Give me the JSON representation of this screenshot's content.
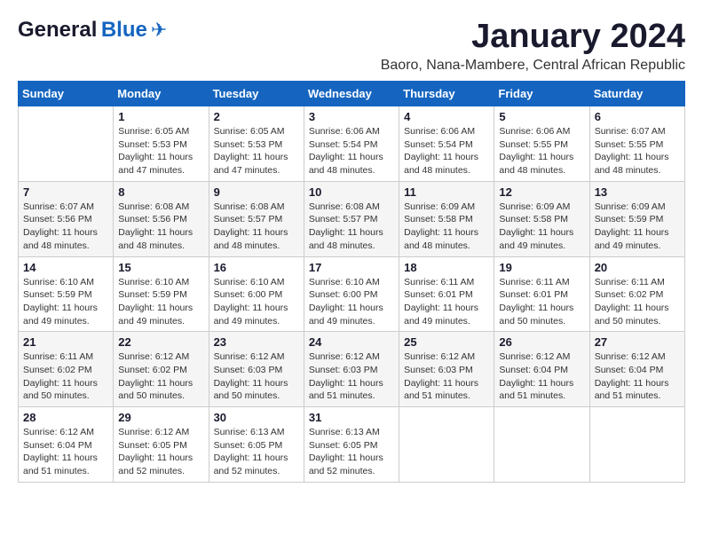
{
  "header": {
    "logo_general": "General",
    "logo_blue": "Blue",
    "month": "January 2024",
    "location": "Baoro, Nana-Mambere, Central African Republic"
  },
  "weekdays": [
    "Sunday",
    "Monday",
    "Tuesday",
    "Wednesday",
    "Thursday",
    "Friday",
    "Saturday"
  ],
  "weeks": [
    [
      {
        "day": "",
        "sunrise": "",
        "sunset": "",
        "daylight": ""
      },
      {
        "day": "1",
        "sunrise": "Sunrise: 6:05 AM",
        "sunset": "Sunset: 5:53 PM",
        "daylight": "Daylight: 11 hours and 47 minutes."
      },
      {
        "day": "2",
        "sunrise": "Sunrise: 6:05 AM",
        "sunset": "Sunset: 5:53 PM",
        "daylight": "Daylight: 11 hours and 47 minutes."
      },
      {
        "day": "3",
        "sunrise": "Sunrise: 6:06 AM",
        "sunset": "Sunset: 5:54 PM",
        "daylight": "Daylight: 11 hours and 48 minutes."
      },
      {
        "day": "4",
        "sunrise": "Sunrise: 6:06 AM",
        "sunset": "Sunset: 5:54 PM",
        "daylight": "Daylight: 11 hours and 48 minutes."
      },
      {
        "day": "5",
        "sunrise": "Sunrise: 6:06 AM",
        "sunset": "Sunset: 5:55 PM",
        "daylight": "Daylight: 11 hours and 48 minutes."
      },
      {
        "day": "6",
        "sunrise": "Sunrise: 6:07 AM",
        "sunset": "Sunset: 5:55 PM",
        "daylight": "Daylight: 11 hours and 48 minutes."
      }
    ],
    [
      {
        "day": "7",
        "sunrise": "Sunrise: 6:07 AM",
        "sunset": "Sunset: 5:56 PM",
        "daylight": "Daylight: 11 hours and 48 minutes."
      },
      {
        "day": "8",
        "sunrise": "Sunrise: 6:08 AM",
        "sunset": "Sunset: 5:56 PM",
        "daylight": "Daylight: 11 hours and 48 minutes."
      },
      {
        "day": "9",
        "sunrise": "Sunrise: 6:08 AM",
        "sunset": "Sunset: 5:57 PM",
        "daylight": "Daylight: 11 hours and 48 minutes."
      },
      {
        "day": "10",
        "sunrise": "Sunrise: 6:08 AM",
        "sunset": "Sunset: 5:57 PM",
        "daylight": "Daylight: 11 hours and 48 minutes."
      },
      {
        "day": "11",
        "sunrise": "Sunrise: 6:09 AM",
        "sunset": "Sunset: 5:58 PM",
        "daylight": "Daylight: 11 hours and 48 minutes."
      },
      {
        "day": "12",
        "sunrise": "Sunrise: 6:09 AM",
        "sunset": "Sunset: 5:58 PM",
        "daylight": "Daylight: 11 hours and 49 minutes."
      },
      {
        "day": "13",
        "sunrise": "Sunrise: 6:09 AM",
        "sunset": "Sunset: 5:59 PM",
        "daylight": "Daylight: 11 hours and 49 minutes."
      }
    ],
    [
      {
        "day": "14",
        "sunrise": "Sunrise: 6:10 AM",
        "sunset": "Sunset: 5:59 PM",
        "daylight": "Daylight: 11 hours and 49 minutes."
      },
      {
        "day": "15",
        "sunrise": "Sunrise: 6:10 AM",
        "sunset": "Sunset: 5:59 PM",
        "daylight": "Daylight: 11 hours and 49 minutes."
      },
      {
        "day": "16",
        "sunrise": "Sunrise: 6:10 AM",
        "sunset": "Sunset: 6:00 PM",
        "daylight": "Daylight: 11 hours and 49 minutes."
      },
      {
        "day": "17",
        "sunrise": "Sunrise: 6:10 AM",
        "sunset": "Sunset: 6:00 PM",
        "daylight": "Daylight: 11 hours and 49 minutes."
      },
      {
        "day": "18",
        "sunrise": "Sunrise: 6:11 AM",
        "sunset": "Sunset: 6:01 PM",
        "daylight": "Daylight: 11 hours and 49 minutes."
      },
      {
        "day": "19",
        "sunrise": "Sunrise: 6:11 AM",
        "sunset": "Sunset: 6:01 PM",
        "daylight": "Daylight: 11 hours and 50 minutes."
      },
      {
        "day": "20",
        "sunrise": "Sunrise: 6:11 AM",
        "sunset": "Sunset: 6:02 PM",
        "daylight": "Daylight: 11 hours and 50 minutes."
      }
    ],
    [
      {
        "day": "21",
        "sunrise": "Sunrise: 6:11 AM",
        "sunset": "Sunset: 6:02 PM",
        "daylight": "Daylight: 11 hours and 50 minutes."
      },
      {
        "day": "22",
        "sunrise": "Sunrise: 6:12 AM",
        "sunset": "Sunset: 6:02 PM",
        "daylight": "Daylight: 11 hours and 50 minutes."
      },
      {
        "day": "23",
        "sunrise": "Sunrise: 6:12 AM",
        "sunset": "Sunset: 6:03 PM",
        "daylight": "Daylight: 11 hours and 50 minutes."
      },
      {
        "day": "24",
        "sunrise": "Sunrise: 6:12 AM",
        "sunset": "Sunset: 6:03 PM",
        "daylight": "Daylight: 11 hours and 51 minutes."
      },
      {
        "day": "25",
        "sunrise": "Sunrise: 6:12 AM",
        "sunset": "Sunset: 6:03 PM",
        "daylight": "Daylight: 11 hours and 51 minutes."
      },
      {
        "day": "26",
        "sunrise": "Sunrise: 6:12 AM",
        "sunset": "Sunset: 6:04 PM",
        "daylight": "Daylight: 11 hours and 51 minutes."
      },
      {
        "day": "27",
        "sunrise": "Sunrise: 6:12 AM",
        "sunset": "Sunset: 6:04 PM",
        "daylight": "Daylight: 11 hours and 51 minutes."
      }
    ],
    [
      {
        "day": "28",
        "sunrise": "Sunrise: 6:12 AM",
        "sunset": "Sunset: 6:04 PM",
        "daylight": "Daylight: 11 hours and 51 minutes."
      },
      {
        "day": "29",
        "sunrise": "Sunrise: 6:12 AM",
        "sunset": "Sunset: 6:05 PM",
        "daylight": "Daylight: 11 hours and 52 minutes."
      },
      {
        "day": "30",
        "sunrise": "Sunrise: 6:13 AM",
        "sunset": "Sunset: 6:05 PM",
        "daylight": "Daylight: 11 hours and 52 minutes."
      },
      {
        "day": "31",
        "sunrise": "Sunrise: 6:13 AM",
        "sunset": "Sunset: 6:05 PM",
        "daylight": "Daylight: 11 hours and 52 minutes."
      },
      {
        "day": "",
        "sunrise": "",
        "sunset": "",
        "daylight": ""
      },
      {
        "day": "",
        "sunrise": "",
        "sunset": "",
        "daylight": ""
      },
      {
        "day": "",
        "sunrise": "",
        "sunset": "",
        "daylight": ""
      }
    ]
  ]
}
